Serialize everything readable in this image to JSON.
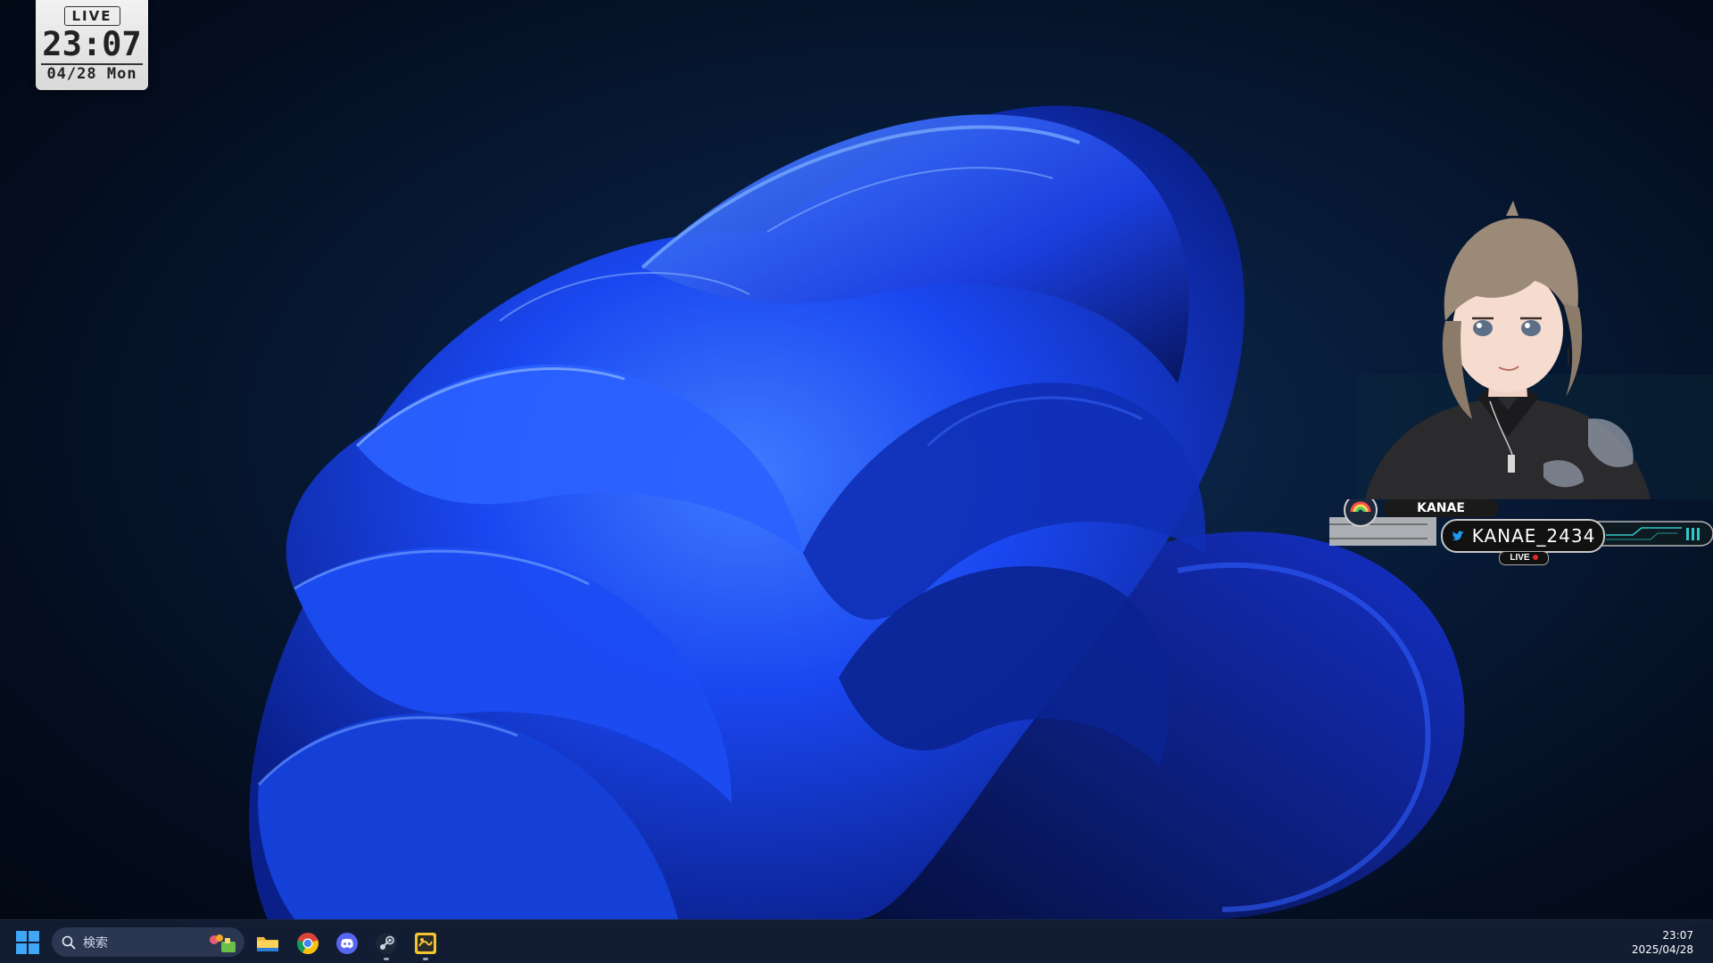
{
  "clock_widget": {
    "badge": "LIVE",
    "time": "23:07",
    "date": "04/28 Mon"
  },
  "vtuber_overlay": {
    "name": "KANAE",
    "handle": "KANAE_2434",
    "live_label": "LIVE",
    "accent_color": "#2fc8c8"
  },
  "taskbar": {
    "search_placeholder": "検索",
    "apps": [
      {
        "name": "file-explorer",
        "icon": "folder-icon"
      },
      {
        "name": "chrome",
        "icon": "chrome-icon"
      },
      {
        "name": "discord",
        "icon": "discord-icon"
      },
      {
        "name": "steam",
        "icon": "steam-icon"
      },
      {
        "name": "streaming-app",
        "icon": "app-icon"
      }
    ],
    "tray_time": "23:07",
    "tray_date": "2025/04/28"
  },
  "colors": {
    "wallpaper_blue": "#1a4bff",
    "background_dark": "#071a36",
    "taskbar": "#141e34"
  }
}
